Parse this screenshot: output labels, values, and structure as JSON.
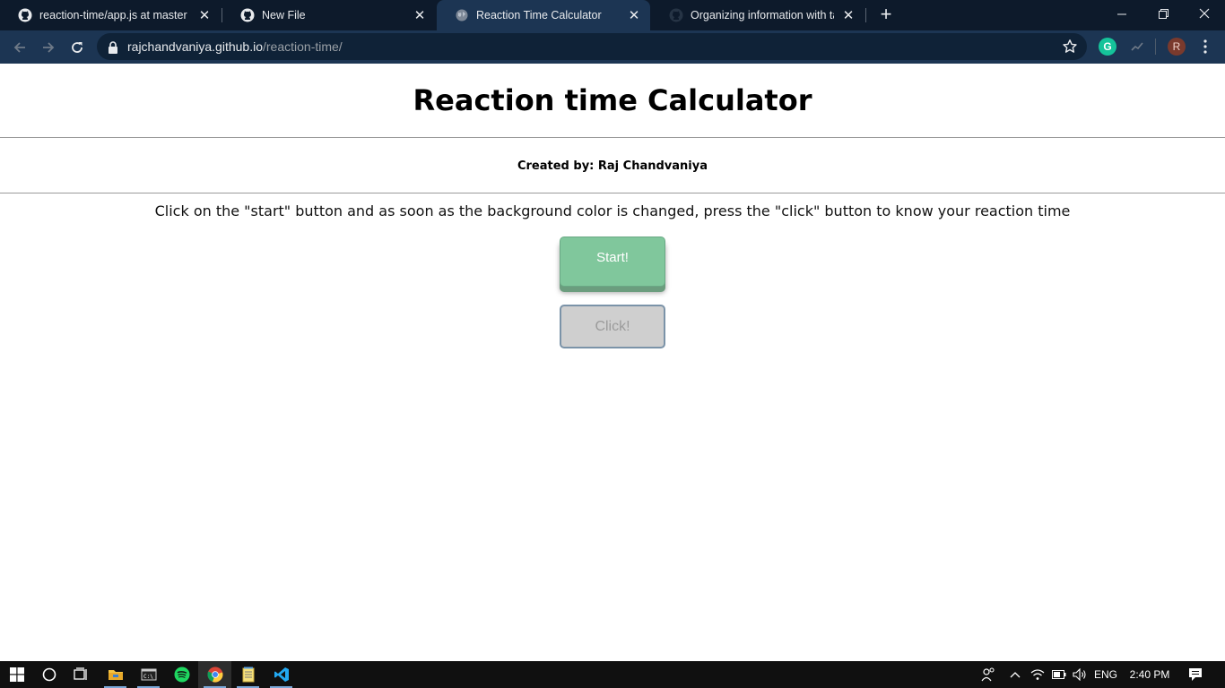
{
  "browser": {
    "tabs": [
      {
        "title": "reaction-time/app.js at master · r",
        "favicon": "github-icon",
        "active": false
      },
      {
        "title": "New File",
        "favicon": "github-icon",
        "active": false
      },
      {
        "title": "Reaction Time Calculator",
        "favicon": "globe-icon",
        "active": true
      },
      {
        "title": "Organizing information with tabl",
        "favicon": "github-icon",
        "active": false
      }
    ],
    "new_tab_label": "+",
    "address": {
      "host": "rajchandvaniya.github.io",
      "path": "/reaction-time/"
    },
    "profile_initial": "R",
    "grammarly_letter": "G"
  },
  "page": {
    "heading": "Reaction time Calculator",
    "credit": "Created by: Raj Chandvaniya",
    "instructions": "Click on the \"start\" button and as soon as the background color is changed, press the \"click\" button to know your reaction time",
    "start_button": "Start!",
    "click_button": "Click!"
  },
  "taskbar": {
    "language": "ENG",
    "time": "2:40 PM"
  },
  "colors": {
    "tab_strip": "#0d1a2b",
    "active_tab": "#1c3553",
    "start_button": "#80c79c",
    "click_button": "#cfcfcf"
  }
}
